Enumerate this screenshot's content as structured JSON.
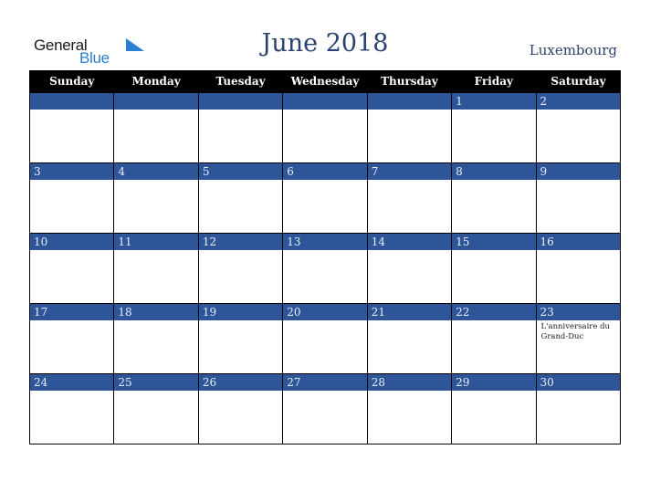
{
  "logo": {
    "word1": "General",
    "word2": "Blue"
  },
  "header": {
    "title": "June 2018",
    "country": "Luxembourg"
  },
  "colors": {
    "header_bg": "#000000",
    "day_bar": "#2d5597",
    "title_text": "#2b4270",
    "logo_blue": "#2a7fd0"
  },
  "weekdays": [
    "Sunday",
    "Monday",
    "Tuesday",
    "Wednesday",
    "Thursday",
    "Friday",
    "Saturday"
  ],
  "weeks": [
    [
      {
        "day": ""
      },
      {
        "day": ""
      },
      {
        "day": ""
      },
      {
        "day": ""
      },
      {
        "day": ""
      },
      {
        "day": "1"
      },
      {
        "day": "2"
      }
    ],
    [
      {
        "day": "3"
      },
      {
        "day": "4"
      },
      {
        "day": "5"
      },
      {
        "day": "6"
      },
      {
        "day": "7"
      },
      {
        "day": "8"
      },
      {
        "day": "9"
      }
    ],
    [
      {
        "day": "10"
      },
      {
        "day": "11"
      },
      {
        "day": "12"
      },
      {
        "day": "13"
      },
      {
        "day": "14"
      },
      {
        "day": "15"
      },
      {
        "day": "16"
      }
    ],
    [
      {
        "day": "17"
      },
      {
        "day": "18"
      },
      {
        "day": "19"
      },
      {
        "day": "20"
      },
      {
        "day": "21"
      },
      {
        "day": "22"
      },
      {
        "day": "23",
        "holiday": "L'anniversaire du Grand-Duc"
      }
    ],
    [
      {
        "day": "24"
      },
      {
        "day": "25"
      },
      {
        "day": "26"
      },
      {
        "day": "27"
      },
      {
        "day": "28"
      },
      {
        "day": "29"
      },
      {
        "day": "30"
      }
    ]
  ]
}
